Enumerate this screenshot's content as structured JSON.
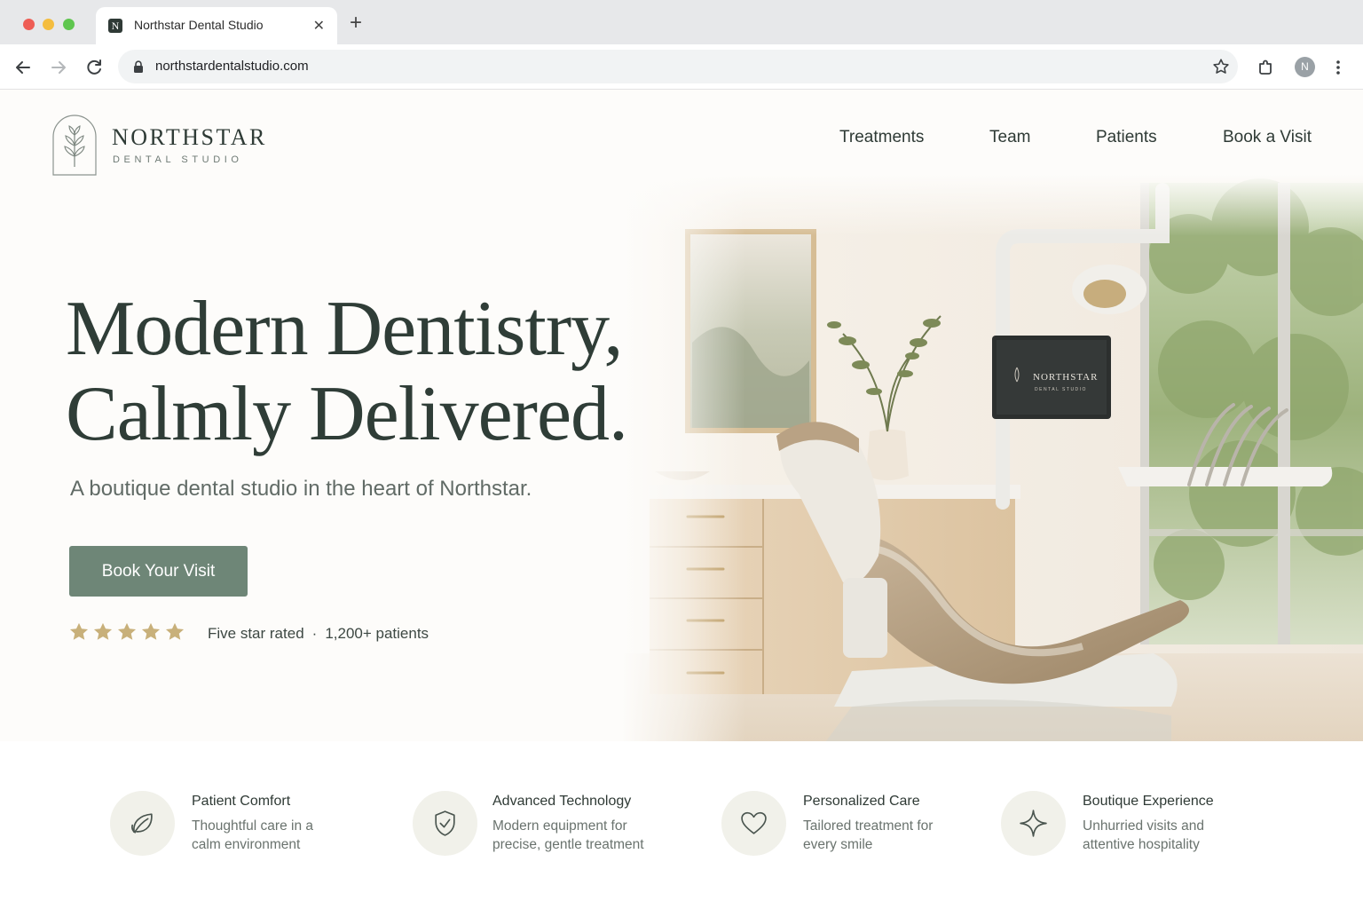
{
  "browser": {
    "tab_title": "Northstar Dental Studio",
    "tab_favicon_letter": "N",
    "url": "northstardentalstudio.com",
    "profile_initial": "N",
    "icons": [
      "back-icon",
      "forward-icon",
      "reload-icon",
      "lock-icon",
      "star-icon",
      "extensions-icon",
      "menu-icon",
      "close-icon",
      "plus-icon"
    ]
  },
  "site": {
    "logo": {
      "name": "NORTHSTAR",
      "sub": "DENTAL STUDIO"
    },
    "nav": [
      {
        "label": "Treatments"
      },
      {
        "label": "Team"
      },
      {
        "label": "Patients"
      },
      {
        "label": "Book a Visit"
      }
    ],
    "hero": {
      "headline_line1": "Modern Dentistry,",
      "headline_line2": "Calmly Delivered.",
      "subhead": "A boutique dental studio in the heart of Northstar.",
      "cta": "Book Your Visit",
      "rating_stars": 5,
      "rating_text": "Five star rated",
      "rating_patients": "1,200+ patients",
      "star_color": "#c8b07a",
      "monitor_logo_name": "NORTHSTAR",
      "monitor_logo_sub": "DENTAL STUDIO"
    },
    "features": [
      {
        "icon": "leaf-icon",
        "title": "Patient Comfort",
        "desc": "Thoughtful care in a calm environment"
      },
      {
        "icon": "shield-check-icon",
        "title": "Advanced Technology",
        "desc": "Modern equipment for precise, gentle treatment"
      },
      {
        "icon": "heart-icon",
        "title": "Personalized Care",
        "desc": "Tailored treatment for every smile"
      },
      {
        "icon": "sparkle-icon",
        "title": "Boutique Experience",
        "desc": "Unhurried visits and attentive hospitality"
      }
    ],
    "colors": {
      "primary": "#6e8677",
      "heading": "#2f3d37",
      "icon_bg": "#f1f1ea"
    }
  }
}
